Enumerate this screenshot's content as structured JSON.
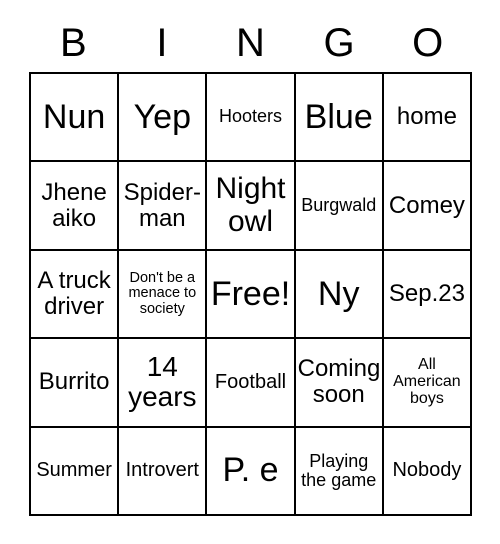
{
  "card": {
    "title": "BINGO",
    "header_letters": [
      "B",
      "I",
      "N",
      "G",
      "O"
    ],
    "free_space_label": "Free!",
    "colors": {
      "border": "#000000",
      "text": "#000000",
      "background": "#ffffff"
    },
    "rows": [
      [
        {
          "text": "Nun",
          "size": "fs-xl"
        },
        {
          "text": "Yep",
          "size": "fs-xl"
        },
        {
          "text": "Hooters",
          "size": "fs-xs"
        },
        {
          "text": "Blue",
          "size": "fs-xl"
        },
        {
          "text": "home",
          "size": "fs-md"
        }
      ],
      [
        {
          "text": "Jhene aiko",
          "size": "fs-md"
        },
        {
          "text": "Spider-man",
          "size": "fs-md"
        },
        {
          "text": "Night owl",
          "size": "fs-lg"
        },
        {
          "text": "Burgwald",
          "size": "fs-xs"
        },
        {
          "text": "Comey",
          "size": "fs-md"
        }
      ],
      [
        {
          "text": "A truck driver",
          "size": "fs-md"
        },
        {
          "text": "Don't be a menace to society",
          "size": "fs-tiny"
        },
        {
          "text": "Free!",
          "size": "fs-xl"
        },
        {
          "text": "Ny",
          "size": "fs-xl"
        },
        {
          "text": "Sep.23",
          "size": "fs-md"
        }
      ],
      [
        {
          "text": "Burrito",
          "size": "fs-md"
        },
        {
          "text": "14 years",
          "size": "fs-ml"
        },
        {
          "text": "Football",
          "size": "fs-sm"
        },
        {
          "text": "Coming soon",
          "size": "fs-md"
        },
        {
          "text": "All American boys",
          "size": "fs-xxs"
        }
      ],
      [
        {
          "text": "Summer",
          "size": "fs-sm"
        },
        {
          "text": "Introvert",
          "size": "fs-sm"
        },
        {
          "text": "P. e",
          "size": "fs-xl"
        },
        {
          "text": "Playing the game",
          "size": "fs-xs"
        },
        {
          "text": "Nobody",
          "size": "fs-sm"
        }
      ]
    ]
  }
}
